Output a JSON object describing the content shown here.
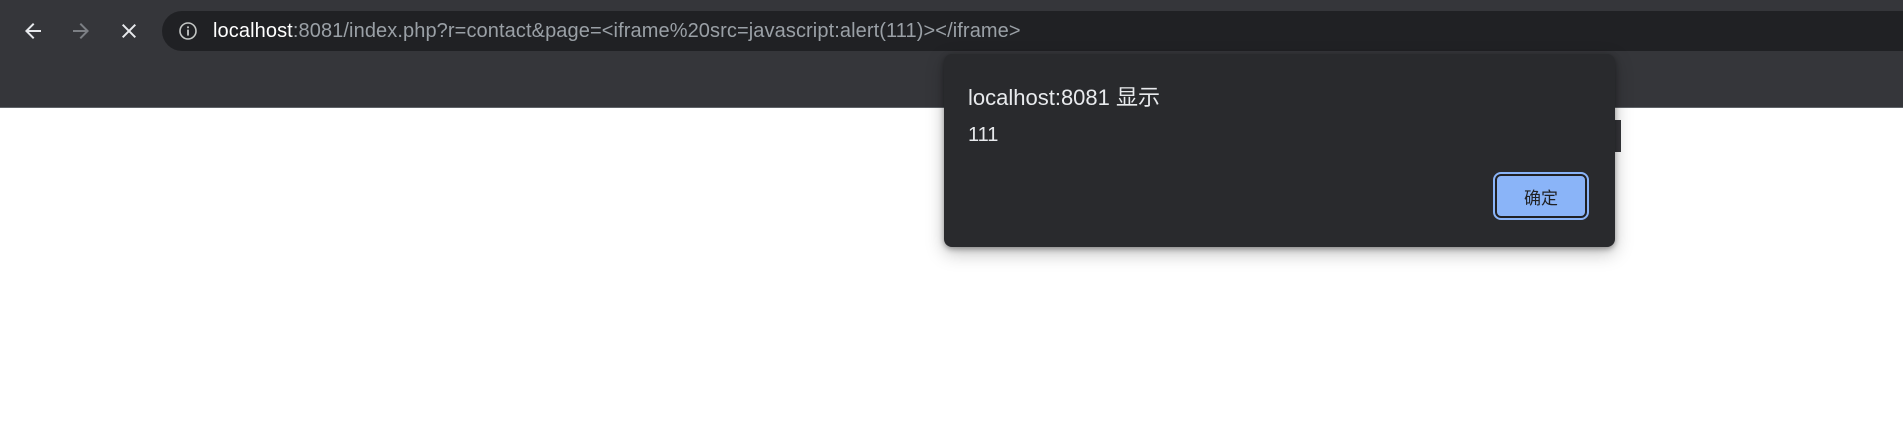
{
  "browser": {
    "url_host": "localhost",
    "url_rest": ":8081/index.php?r=contact&page=<iframe%20src=javascript:alert(111)></iframe>",
    "icons": {
      "back": "arrow-left-icon",
      "forward": "arrow-right-icon",
      "stop": "close-icon",
      "site_info": "info-icon"
    },
    "colors": {
      "chrome": "#35363a",
      "omnibox": "#202124",
      "url_host": "#ffffff",
      "url_rest": "#9aa0a6"
    }
  },
  "dialog": {
    "title": "localhost:8081 显示",
    "message": "111",
    "ok_label": "确定",
    "colors": {
      "background": "#292a2d",
      "text": "#e8eaed",
      "button": "#8ab4f8"
    }
  }
}
